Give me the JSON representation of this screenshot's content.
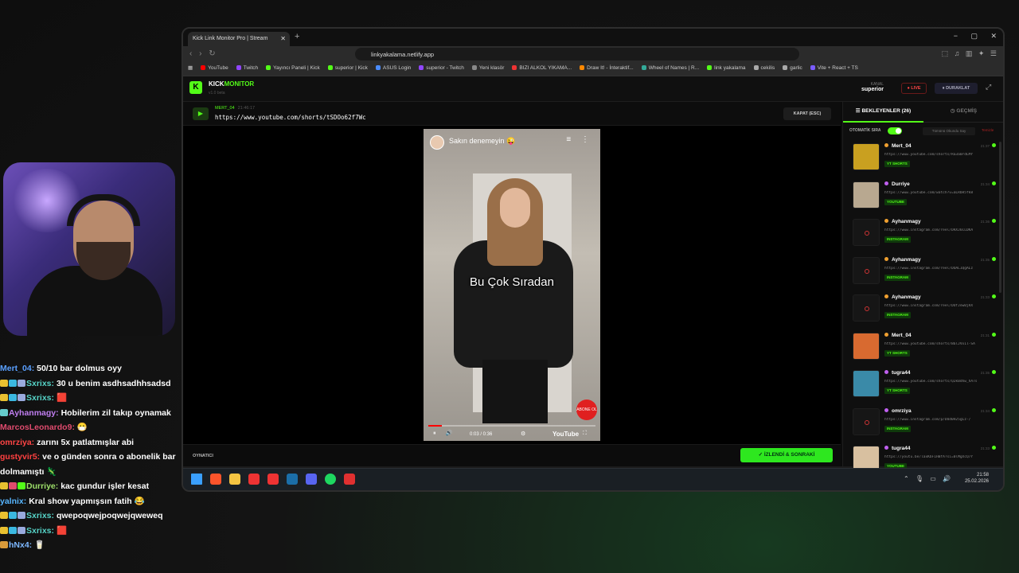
{
  "chat": [
    {
      "user": "Mert_04:",
      "text": "50/10 bar dolmus oyy",
      "color": "#5aa0ff",
      "badges": []
    },
    {
      "user": "Sxrixs:",
      "text": "30 u benim asdhsadhhsadsd",
      "color": "#56d4c8",
      "badges": [
        "#e8c030",
        "#3bb8e0",
        "#9ad"
      ]
    },
    {
      "user": "Sxrixs:",
      "text": "🟥",
      "color": "#56d4c8",
      "badges": [
        "#e8c030",
        "#3bb8e0",
        "#9ad"
      ]
    },
    {
      "user": "Ayhanmagy:",
      "text": "Hobilerim zil takıp oynamak",
      "color": "#c07ef0",
      "badges": [
        "#6cc"
      ]
    },
    {
      "user": "MarcosLeonardo9:",
      "text": "😷",
      "color": "#e04b6e",
      "badges": []
    },
    {
      "user": "omrziya:",
      "text": "zarını 5x patlatmışlar abi",
      "color": "#ff4545",
      "badges": []
    },
    {
      "user": "gustyvir5:",
      "text": "ve o günden sonra o abonelik bar",
      "color": "#ff4040",
      "badges": []
    },
    {
      "user": "",
      "text": "dolmamıştı 🦎",
      "color": "#fff",
      "badges": []
    },
    {
      "user": "Durriye:",
      "text": "kac gundur işler kesat",
      "color": "#9ee06a",
      "badges": [
        "#e8c030",
        "#e04b6e",
        "#53fc18"
      ]
    },
    {
      "user": "yalnix:",
      "text": "Kral show yapmışsın fatih 😂",
      "color": "#57b6ff",
      "badges": []
    },
    {
      "user": "Sxrixs:",
      "text": "qwepoqwejpoqwejqweweq",
      "color": "#56d4c8",
      "badges": [
        "#e8c030",
        "#3bb8e0",
        "#9ad"
      ]
    },
    {
      "user": "Sxrixs:",
      "text": "🟥",
      "color": "#56d4c8",
      "badges": [
        "#e8c030",
        "#3bb8e0",
        "#9ad"
      ]
    },
    {
      "user": "hNx4:",
      "text": "🥛",
      "color": "#7db8ff",
      "badges": [
        "#d89a3a"
      ]
    }
  ],
  "browser": {
    "tab_title": "Kick Link Monitor Pro | Stream",
    "url": "linkyakalama.netlify.app",
    "bookmarks": [
      {
        "label": "YouTube",
        "color": "#ff0000"
      },
      {
        "label": "Twitch",
        "color": "#9146ff"
      },
      {
        "label": "Yayıncı Paneli | Kick",
        "color": "#53fc18"
      },
      {
        "label": "superior | Kick",
        "color": "#53fc18"
      },
      {
        "label": "ASUS Login",
        "color": "#4a8cff"
      },
      {
        "label": "superior - Twitch",
        "color": "#9146ff"
      },
      {
        "label": "Yeni klasör",
        "color": "#888"
      },
      {
        "label": "BIZI ALKOL YIKAMA...",
        "color": "#e33"
      },
      {
        "label": "Draw It! - İnteraktif...",
        "color": "#f80"
      },
      {
        "label": "Wheel of Names | R...",
        "color": "#3a9"
      },
      {
        "label": "link yakalama",
        "color": "#53fc18"
      },
      {
        "label": "cekilis",
        "color": "#aaa"
      },
      {
        "label": "garlic",
        "color": "#aaa"
      },
      {
        "label": "Vite + React + TS",
        "color": "#7a5cff"
      }
    ]
  },
  "app": {
    "brand_a": "KICK",
    "brand_b": "MONITOR",
    "version": "v1.0 beta",
    "channel_label": "KANAL",
    "channel_name": "superior",
    "live_label": "LIVE",
    "pause_label": "DURAKLAT",
    "current_user": "MERT_04",
    "current_time": "21:46:17",
    "current_link": "https://www.youtube.com/shorts/tSDOo62f7Wc",
    "close_label": "KAPAT (ESC)",
    "player_label": "OYNATICI",
    "next_label": "İZLENDİ & SONRAKİ",
    "video": {
      "title": "Sakın denemeyin 😜",
      "caption": "Bu Çok Sıradan",
      "time": "0:03 / 0:36",
      "progress": 0.083,
      "platform": "YouTube",
      "subscribe": "ABONE OL"
    },
    "queue": {
      "tab_waiting": "BEKLEYENLER (26)",
      "tab_history": "GEÇMİŞ",
      "auto_label": "OTOMATİK SIRA",
      "mark_all": "Tümünü Okundu Say",
      "clear": "Temizle",
      "items": [
        {
          "user": "Mert_04",
          "time": "21:37",
          "url": "https://www.youtube.com/shorts/Ra3a0rdLMY",
          "tag": "YT SHORTS",
          "user_color": "#f0a030",
          "thumb": "#c9a020"
        },
        {
          "user": "Durriye",
          "time": "21:34",
          "url": "https://www.youtube.com/watch?v=aLRbH5fk8",
          "tag": "YOUTUBE",
          "user_color": "#c060f0",
          "thumb": "#b8a890"
        },
        {
          "user": "Ayhanmagy",
          "time": "21:36",
          "url": "https://www.instagram.com/reel/DRXJ6CLDKA",
          "tag": "INSTAGRAM",
          "user_color": "#f0a030",
          "thumb": ""
        },
        {
          "user": "Ayhanmagy",
          "time": "21:35",
          "url": "https://www.instagram.com/reel/DOALIQgALz",
          "tag": "INSTAGRAM",
          "user_color": "#f0a030",
          "thumb": ""
        },
        {
          "user": "Ayhanmagy",
          "time": "21:33",
          "url": "https://www.instagram.com/reel/DUfJow0jRX",
          "tag": "INSTAGRAM",
          "user_color": "#f0a030",
          "thumb": ""
        },
        {
          "user": "Mert_04",
          "time": "21:31",
          "url": "https://www.youtube.com/shorts/B6lJVx1l-SA",
          "tag": "YT SHORTS",
          "user_color": "#f0a030",
          "thumb": "#d86a30"
        },
        {
          "user": "tugra44",
          "time": "21:35",
          "url": "https://www.youtube.com/shorts/Q2k0dhw_hA7s",
          "tag": "YT SHORTS",
          "user_color": "#c060f0",
          "thumb": "#3a8aa8"
        },
        {
          "user": "omrziya",
          "time": "21:34",
          "url": "https://www.instagram.com/p/DUd0H25gLz-/",
          "tag": "INSTAGRAM",
          "user_color": "#c060f0",
          "thumb": ""
        },
        {
          "user": "tugra44",
          "time": "21:33",
          "url": "https://youtu.be/laxKbF1HBfA?si=0lMgXcQ7Y",
          "tag": "YOUTUBE",
          "user_color": "#c060f0",
          "thumb": "#d8c0a0"
        }
      ]
    }
  },
  "taskbar": {
    "time": "21:58",
    "date": "25.02.2026",
    "apps": [
      {
        "name": "start-icon",
        "color": "#3aa0ff"
      },
      {
        "name": "brave-icon",
        "color": "#fb542b"
      },
      {
        "name": "folder-icon",
        "color": "#f5c542"
      },
      {
        "name": "pin-icon",
        "color": "#e33"
      },
      {
        "name": "kick-app-icon",
        "color": "#e33"
      },
      {
        "name": "steam-icon",
        "color": "#1b6ea8"
      },
      {
        "name": "discord-icon",
        "color": "#5865f2"
      },
      {
        "name": "spotify-icon",
        "color": "#1ed760"
      },
      {
        "name": "app-icon",
        "color": "#e03030"
      }
    ]
  }
}
